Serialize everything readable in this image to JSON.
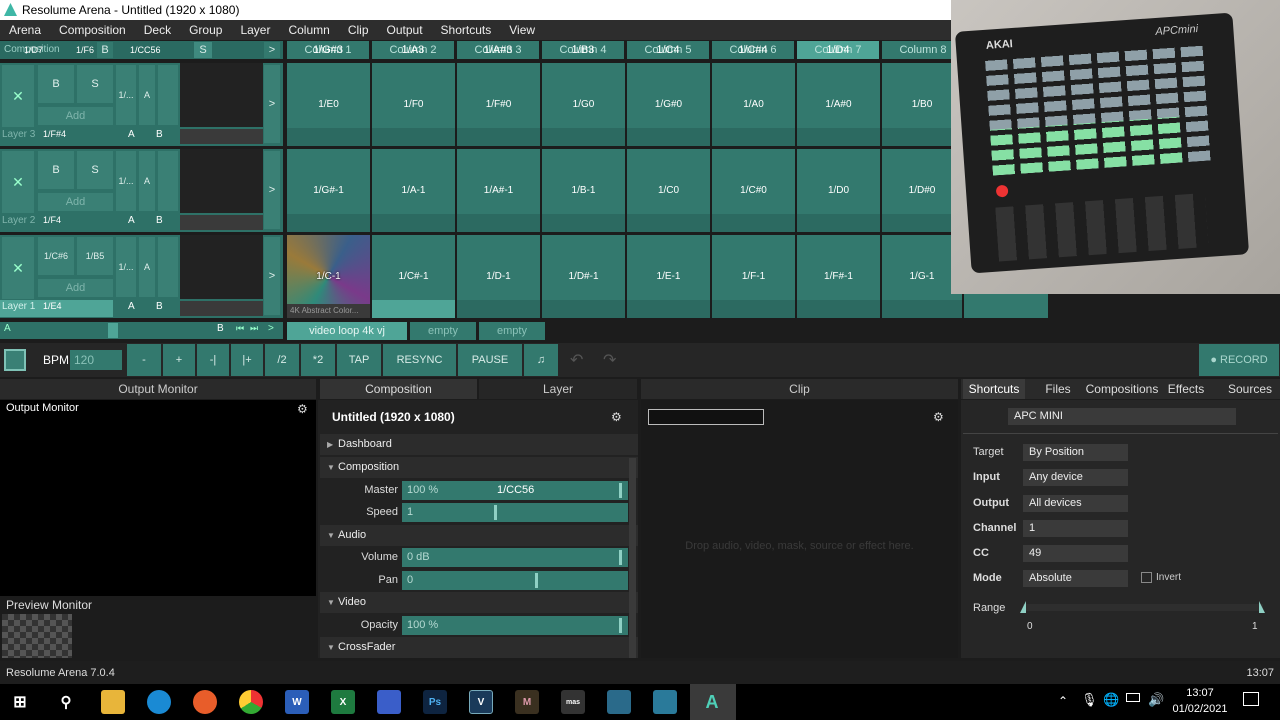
{
  "window": {
    "title": "Resolume Arena - Untitled (1920 x 1080)"
  },
  "menu": [
    "Arena",
    "Composition",
    "Deck",
    "Group",
    "Layer",
    "Column",
    "Clip",
    "Output",
    "Shortcuts",
    "View"
  ],
  "header": {
    "composition": "Composition",
    "comp_shortcut": "1/D7",
    "f6": "1/F6",
    "b": "B",
    "cc56": "1/CC56",
    "s": "S",
    "arrow": ">",
    "columns": [
      {
        "label": "Column 1",
        "shortcut": "1/G#3"
      },
      {
        "label": "Column 2",
        "shortcut": "1/A3"
      },
      {
        "label": "Column 3",
        "shortcut": "1/A#3"
      },
      {
        "label": "Column 4",
        "shortcut": "1/B3"
      },
      {
        "label": "Column 5",
        "shortcut": "1/C4"
      },
      {
        "label": "Column 6",
        "shortcut": "1/C#4"
      },
      {
        "label": "Column 7",
        "shortcut": "1/D4"
      },
      {
        "label": "Column 8",
        "shortcut": ""
      }
    ]
  },
  "layers": [
    {
      "name": "Layer 3",
      "shortcut": "1/F#4",
      "b": "B",
      "s": "S",
      "slot1": "",
      "slot2": "",
      "add": "Add",
      "m": "M",
      "a": "A",
      "mval": "1/...",
      "ab_a": "A",
      "ab_b": "B",
      "arrow": ">",
      "clips": [
        "1/E0",
        "1/F0",
        "1/F#0",
        "1/G0",
        "1/G#0",
        "1/A0",
        "1/A#0",
        "1/B0"
      ]
    },
    {
      "name": "Layer 2",
      "shortcut": "1/F4",
      "b": "B",
      "s": "S",
      "slot1": "",
      "slot2": "",
      "add": "Add",
      "m": "M",
      "a": "A",
      "mval": "1/...",
      "ab_a": "A",
      "ab_b": "B",
      "arrow": ">",
      "clips": [
        "1/G#-1",
        "1/A-1",
        "1/A#-1",
        "1/B-1",
        "1/C0",
        "1/C#0",
        "1/D0",
        "1/D#0"
      ]
    },
    {
      "name": "Layer 1",
      "shortcut": "1/E4",
      "b": "1/C#6",
      "s": "1/B5",
      "add": "Add",
      "m": "M",
      "a": "A",
      "mval": "1/...",
      "ab_a": "A",
      "ab_b": "B",
      "arrow": ">",
      "clips": [
        "1/C-1",
        "1/C#-1",
        "1/D-1",
        "1/D#-1",
        "1/E-1",
        "1/F-1",
        "1/F#-1",
        "1/G-1"
      ],
      "first_clip_caption": "4K Abstract Color..."
    }
  ],
  "deck_bar": {
    "a": "A",
    "b": "B",
    "arrow": ">",
    "tabs": [
      "video loop 4k vj",
      "empty",
      "empty"
    ]
  },
  "transport": {
    "bpm_label": "BPM",
    "bpm_value": "120",
    "buttons": [
      "-",
      "+",
      "-|",
      "|+",
      "/2",
      "*2",
      "TAP",
      "RESYNC",
      "PAUSE"
    ],
    "record": "● RECORD"
  },
  "output_monitor": {
    "header": "Output Monitor",
    "title": "Output Monitor",
    "preview": "Preview Monitor"
  },
  "composition_panel": {
    "tabs": [
      "Composition",
      "Layer"
    ],
    "title": "Untitled (1920 x 1080)",
    "dashboard": "Dashboard",
    "section_composition": "Composition",
    "master_label": "Master",
    "master_value": "100 %",
    "master_shortcut": "1/CC56",
    "speed_label": "Speed",
    "speed_value": "1",
    "section_audio": "Audio",
    "volume_label": "Volume",
    "volume_value": "0 dB",
    "pan_label": "Pan",
    "pan_value": "0",
    "section_video": "Video",
    "opacity_label": "Opacity",
    "opacity_value": "100 %",
    "crossfader": "CrossFader"
  },
  "clip_panel": {
    "header": "Clip",
    "hint": "Drop audio, video, mask, source or effect here."
  },
  "shortcuts_panel": {
    "tabs": [
      "Shortcuts",
      "Files",
      "Compositions",
      "Effects",
      "Sources"
    ],
    "device": "APC MINI",
    "target_label": "Target",
    "target_value": "By Position",
    "input_label": "Input",
    "input_value": "Any device",
    "output_label": "Output",
    "output_value": "All devices",
    "channel_label": "Channel",
    "channel_value": "1",
    "cc_label": "CC",
    "cc_value": "49",
    "mode_label": "Mode",
    "mode_value": "Absolute",
    "invert_label": "Invert",
    "range_label": "Range",
    "range_min": "0",
    "range_max": "1"
  },
  "statusbar": {
    "left": "Resolume Arena 7.0.4",
    "right": "13:07"
  },
  "overlay": {
    "brand": "AKAI",
    "model": "APCmini"
  },
  "taskbar": {
    "time": "13:07",
    "date": "01/02/2021"
  }
}
